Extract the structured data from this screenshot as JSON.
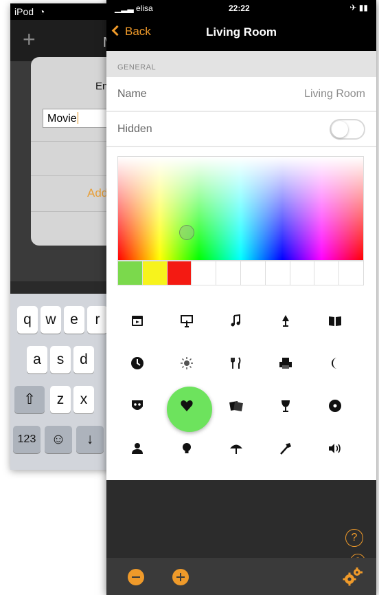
{
  "back_phone": {
    "status": {
      "device": "iPod"
    },
    "nav_title": "M",
    "dialog": {
      "title": "En",
      "input_value": "Movie",
      "add_label": "Add"
    },
    "keyboard": {
      "row1": [
        "q",
        "w",
        "e",
        "r"
      ],
      "row2": [
        "a",
        "s",
        "d"
      ],
      "row3": [
        "z",
        "x"
      ],
      "numbers_key": "123"
    }
  },
  "front_phone": {
    "status": {
      "carrier": "elisa",
      "time": "22:22"
    },
    "nav": {
      "back_label": "Back",
      "title": "Living Room"
    },
    "section_header": "GENERAL",
    "name_row": {
      "label": "Name",
      "value": "Living Room"
    },
    "hidden_row": {
      "label": "Hidden",
      "toggle_on": false
    },
    "color_picker": {
      "swatches": [
        "#7bd94c",
        "#f7f31c",
        "#f41a12",
        "",
        "",
        "",
        "",
        "",
        "",
        ""
      ]
    },
    "icons": [
      "film-icon",
      "screen-icon",
      "music-note-icon",
      "lamp-icon",
      "book-icon",
      "clock-icon",
      "sun-icon",
      "cutlery-icon",
      "printer-icon",
      "moon-icon",
      "mask-icon",
      "heart-icon",
      "photos-icon",
      "wine-glass-icon",
      "cd-icon",
      "person-icon",
      "bulb-icon",
      "umbrella-icon",
      "hammer-icon",
      "speaker-icon"
    ],
    "selected_icon": "bulb-icon",
    "help_symbol": "?",
    "accent_color": "#ef9a2a"
  }
}
